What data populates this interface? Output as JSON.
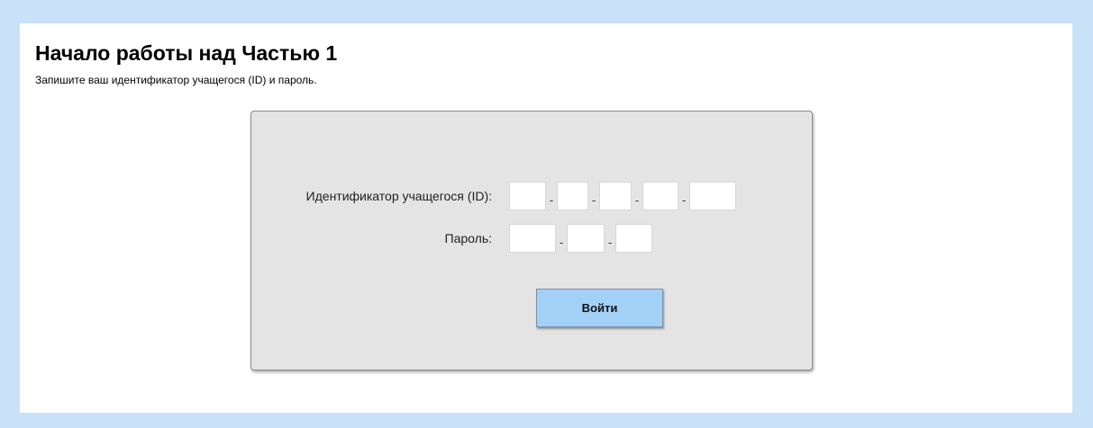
{
  "header": {
    "title": "Начало работы над Частью 1",
    "subtitle": "Запишите ваш идентификатор учащегося (ID) и пароль."
  },
  "login_form": {
    "student_id_label": "Идентификатор учащегося (ID):",
    "password_label": "Пароль:",
    "separator": "-",
    "student_id_values": [
      "",
      "",
      "",
      "",
      ""
    ],
    "password_values": [
      "",
      "",
      ""
    ],
    "submit_label": "Войти"
  },
  "colors": {
    "page_background": "#c9e2f7",
    "panel_background": "#ffffff",
    "form_background": "#e4e4e4",
    "button_background": "#a3d0f7"
  }
}
